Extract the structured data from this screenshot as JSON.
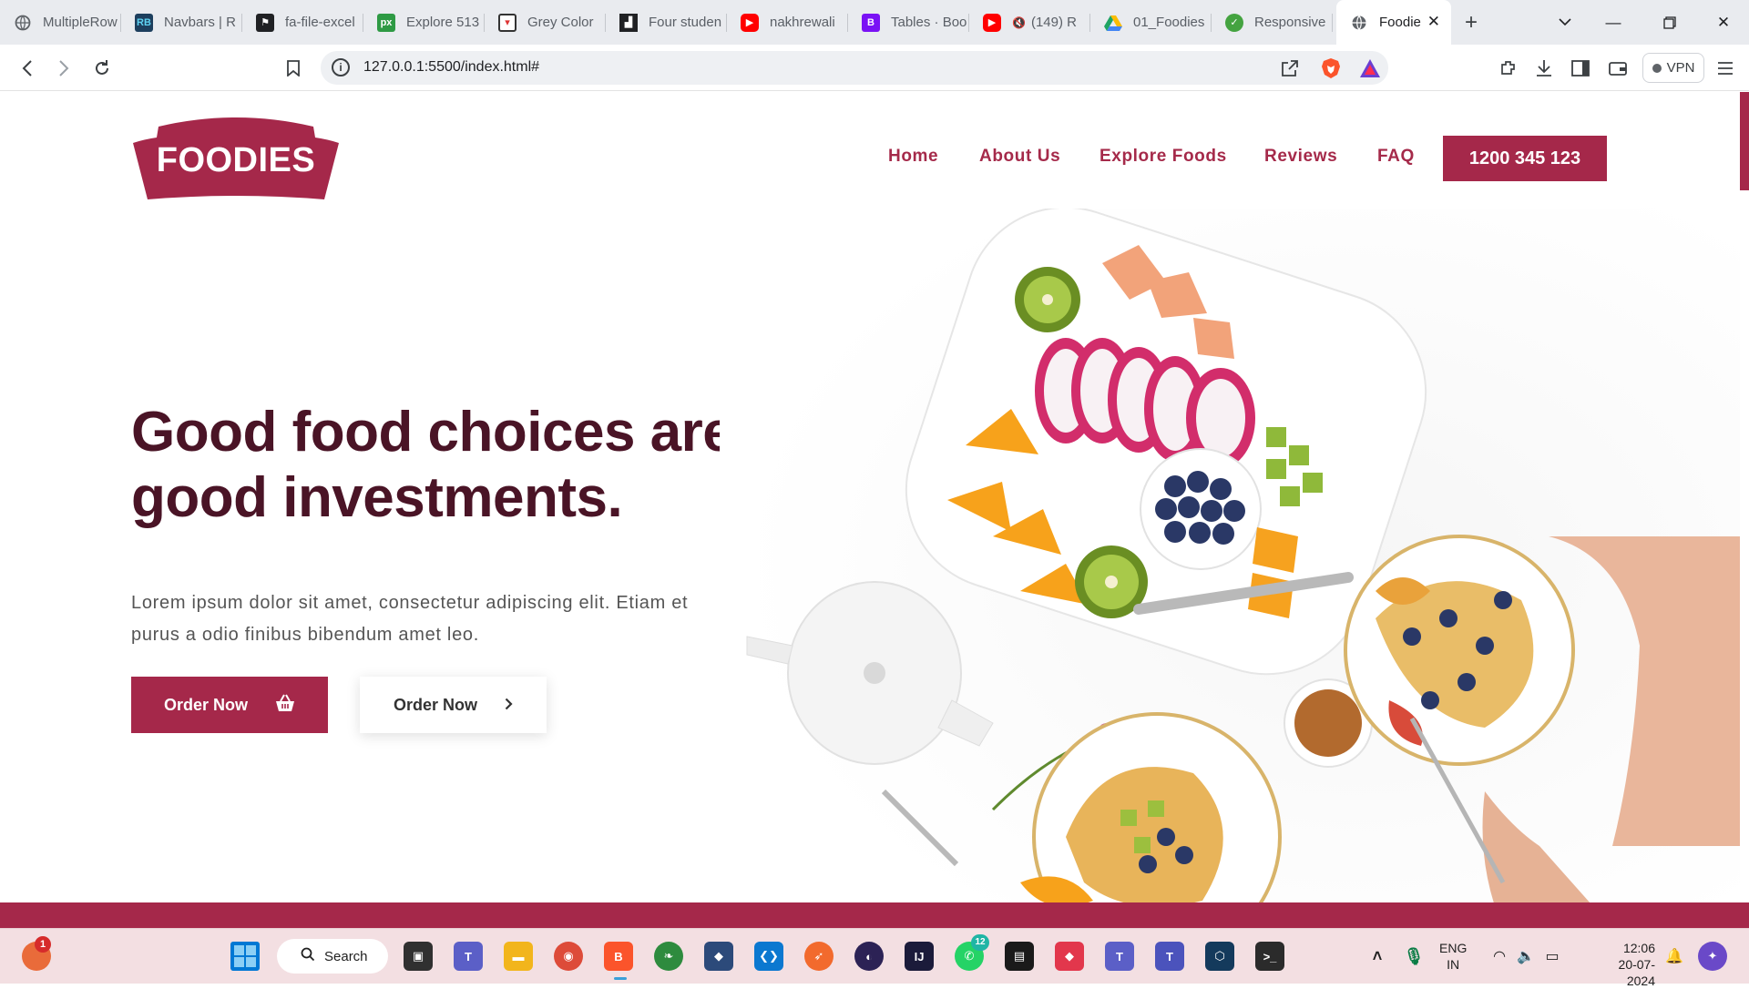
{
  "browser": {
    "tabs": [
      {
        "title": "MultipleRow",
        "favicon": "globe-icon",
        "color": "#5f6368"
      },
      {
        "title": "Navbars | R",
        "favicon": "react-bootstrap-icon",
        "color": "#1d3f5e"
      },
      {
        "title": "fa-file-excel",
        "favicon": "flag-icon",
        "color": "#202124"
      },
      {
        "title": "Explore 513",
        "favicon": "px-icon",
        "color": "#2e9a44"
      },
      {
        "title": "Grey Color",
        "favicon": "cup-icon",
        "color": "#d33"
      },
      {
        "title": "Four studen",
        "favicon": "blocks-icon",
        "color": "#202124"
      },
      {
        "title": "nakhrewali",
        "favicon": "youtube-icon",
        "color": "#ff0000"
      },
      {
        "title": "Tables · Boo",
        "favicon": "bootstrap-icon",
        "color": "#7a12f5"
      },
      {
        "title": "(149) R",
        "favicon": "youtube-muted-icon",
        "color": "#ff0000"
      },
      {
        "title": "01_Foodies",
        "favicon": "google-drive-icon",
        "color": "#1fa463"
      },
      {
        "title": "Responsive",
        "favicon": "leaf-icon",
        "color": "#44a340"
      },
      {
        "title": "Foodie",
        "favicon": "globe-icon",
        "color": "#5f6368",
        "active": true
      }
    ],
    "url": "127.0.0.1:5500/index.html#",
    "vpn_label": "VPN"
  },
  "site": {
    "logo_text": "FOODIES",
    "nav": [
      "Home",
      "About Us",
      "Explore Foods",
      "Reviews",
      "FAQ"
    ],
    "phone": "1200 345 123",
    "hero_title_line1": "Good food choices are",
    "hero_title_line2": "good investments.",
    "hero_text_line1": "Lorem ipsum dolor sit amet, consectetur adipiscing elit. Etiam et",
    "hero_text_line2": "purus a odio finibus bibendum amet leo.",
    "btn_primary": "Order Now",
    "btn_secondary": "Order Now",
    "accent": "#a5284a",
    "title_color": "#4a1426"
  },
  "taskbar": {
    "search_label": "Search",
    "lang_line1": "ENG",
    "lang_line2": "IN",
    "time": "12:06",
    "date": "20-07-2024",
    "notif_badge": "1",
    "whatsapp_badge": "12"
  }
}
